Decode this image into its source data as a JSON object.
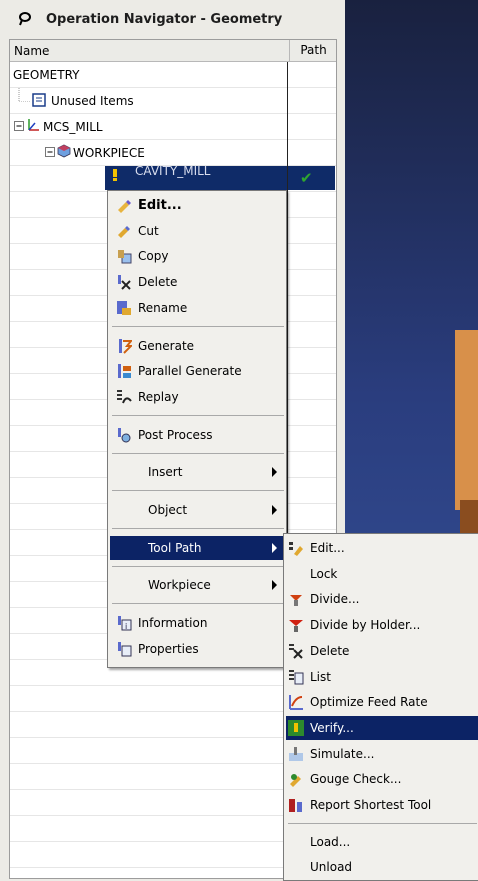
{
  "panel": {
    "title": "Operation Navigator - Geometry"
  },
  "tree": {
    "columns": {
      "name": "Name",
      "path": "Path"
    },
    "root": "GEOMETRY",
    "items": [
      {
        "label": "Unused Items"
      },
      {
        "label": "MCS_MILL"
      },
      {
        "label": "WORKPIECE"
      },
      {
        "label": "CAVITY_MILL"
      }
    ],
    "path_status": "✔"
  },
  "context_menu": {
    "items": [
      {
        "label": "Edit...",
        "icon": "edit-icon"
      },
      {
        "label": "Cut",
        "icon": "cut-icon"
      },
      {
        "label": "Copy",
        "icon": "copy-icon"
      },
      {
        "label": "Delete",
        "icon": "delete-icon"
      },
      {
        "label": "Rename",
        "icon": "rename-icon"
      },
      {
        "label": "Generate",
        "icon": "generate-icon"
      },
      {
        "label": "Parallel Generate",
        "icon": "parallel-generate-icon"
      },
      {
        "label": "Replay",
        "icon": "replay-icon"
      },
      {
        "label": "Post Process",
        "icon": "post-process-icon"
      },
      {
        "label": "Insert"
      },
      {
        "label": "Object"
      },
      {
        "label": "Tool Path"
      },
      {
        "label": "Workpiece"
      },
      {
        "label": "Information",
        "icon": "information-icon"
      },
      {
        "label": "Properties",
        "icon": "properties-icon"
      }
    ]
  },
  "submenu": {
    "items": [
      {
        "label": "Edit...",
        "icon": "edit-icon"
      },
      {
        "label": "Lock"
      },
      {
        "label": "Divide...",
        "icon": "divide-icon"
      },
      {
        "label": "Divide by Holder...",
        "icon": "divide-holder-icon"
      },
      {
        "label": "Delete",
        "icon": "delete-icon"
      },
      {
        "label": "List",
        "icon": "list-icon"
      },
      {
        "label": "Optimize Feed Rate",
        "icon": "optimize-icon"
      },
      {
        "label": "Verify...",
        "icon": "verify-icon"
      },
      {
        "label": "Simulate...",
        "icon": "simulate-icon"
      },
      {
        "label": "Gouge Check...",
        "icon": "gouge-check-icon"
      },
      {
        "label": "Report Shortest Tool",
        "icon": "report-icon"
      },
      {
        "label": "Load..."
      },
      {
        "label": "Unload"
      }
    ]
  },
  "colors": {
    "selection": "#0f2b68",
    "check": "#2fa52f"
  }
}
